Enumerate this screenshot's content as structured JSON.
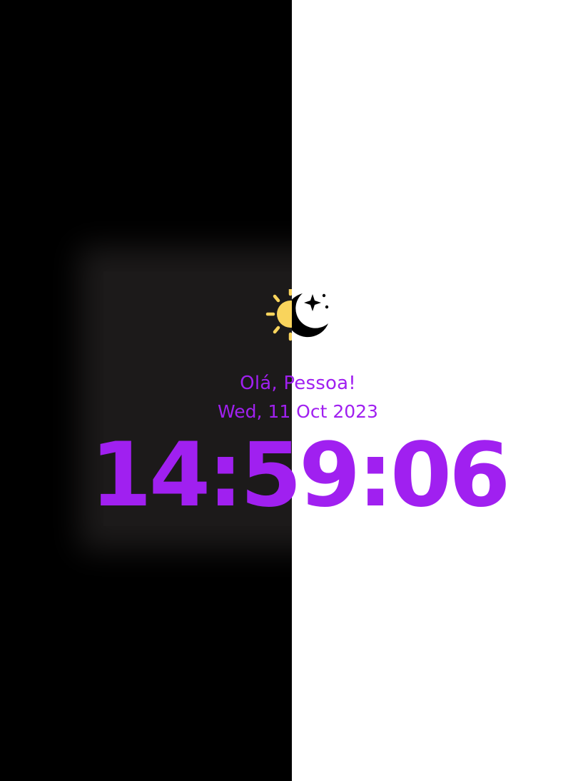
{
  "theme": {
    "accent_color": "#a020f0",
    "dark_background": "#000000",
    "dark_card_color": "#1c1a1a",
    "light_background": "#ffffff",
    "sun_color": "#f9d45c"
  },
  "theme_toggle": {
    "left_icon": "sun-icon",
    "right_icon": "moon-icon"
  },
  "clock": {
    "greeting": "Olá, Pessoa!",
    "date": "Wed, 11 Oct 2023",
    "time": "14:59:06"
  }
}
